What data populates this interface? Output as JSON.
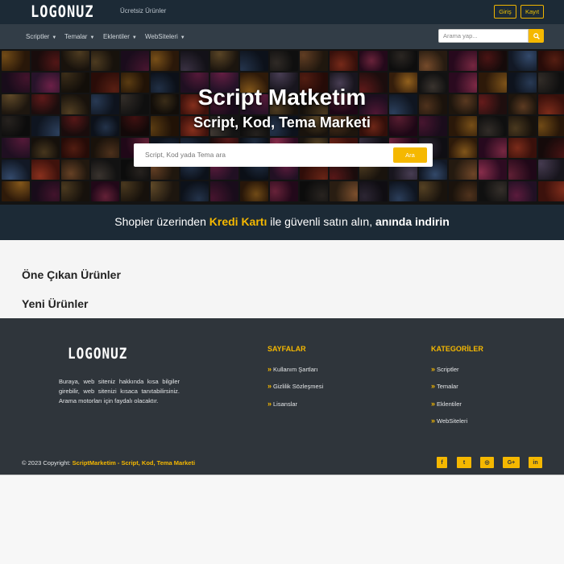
{
  "topbar": {
    "logo": "LOGONUZ",
    "free_products": "Ücretsiz Ürünler",
    "login": "Giriş",
    "register": "Kayıt"
  },
  "nav": {
    "items": [
      "Scriptler",
      "Temalar",
      "Eklentiler",
      "WebSiteleri"
    ],
    "search_placeholder": "Arama yap...",
    "search_icon": "search-icon"
  },
  "hero": {
    "title": "Script Matketim",
    "subtitle": "Script, Kod, Tema Marketi",
    "search_placeholder": "Script, Kod yada Tema ara",
    "search_button": "Ara"
  },
  "banner": {
    "part1": "Shopier üzerinden ",
    "highlight": "Kredi Kartı",
    "part2": " ile güvenli satın alın, ",
    "strong": "anında indirin"
  },
  "main": {
    "featured": "Öne Çıkan Ürünler",
    "new": "Yeni Ürünler"
  },
  "footer": {
    "logo": "LOGONUZ",
    "about": "Buraya, web siteniz hakkında kısa bilgiler girebilir, web sitenizi kısaca tanıtabilirsiniz. Arama motorları için faydalı olacaktır.",
    "pages_title": "SAYFALAR",
    "pages": [
      "Kullanım Şartları",
      "Gizlilik Sözleşmesi",
      "Lisanslar"
    ],
    "categories_title": "KATEGORİLER",
    "categories": [
      "Scriptler",
      "Temalar",
      "Eklentiler",
      "WebSiteleri"
    ],
    "copyright_prefix": "© 2023 Copyright: ",
    "copyright_brand": "ScriptMarketim - Script, Kod, Tema Marketi",
    "social": [
      {
        "icon": "facebook-icon",
        "glyph": "f"
      },
      {
        "icon": "twitter-icon",
        "glyph": "t"
      },
      {
        "icon": "instagram-icon",
        "glyph": "◎"
      },
      {
        "icon": "google-plus-icon",
        "glyph": "G+"
      },
      {
        "icon": "linkedin-icon",
        "glyph": "in"
      }
    ]
  },
  "colors": {
    "accent": "#f5b800",
    "topbar": "#1c2a36",
    "navbar": "#323d47",
    "footer": "#2f353b"
  }
}
